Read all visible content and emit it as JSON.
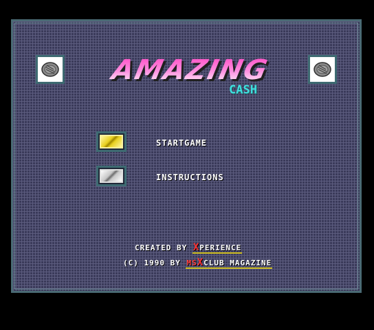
{
  "title": {
    "logo_text": "AMAZING",
    "subtitle_text": "CASH"
  },
  "menu": {
    "items": [
      {
        "label": "STARTGAME",
        "button_color": "#e8d020"
      },
      {
        "label": "INSTRUCTIONS",
        "button_color": "#b8b8b8"
      }
    ]
  },
  "credits": {
    "created_by": "CREATED BY",
    "created_brand_x": "X",
    "created_brand_rest": "PERIENCE",
    "copyright": "(C) 1990 BY",
    "magazine_ms": "MS",
    "magazine_x": "X",
    "magazine_rest": "CLUB MAGAZINE"
  },
  "colors": {
    "logo_gradient_top": "#ff40c0",
    "logo_gradient_bottom": "#ffffff",
    "subtitle": "#40e0e0",
    "frame": "#3e6b72",
    "background": "#3a3a5a"
  },
  "icons": {
    "coin_left": "coin-icon",
    "coin_right": "coin-icon"
  }
}
